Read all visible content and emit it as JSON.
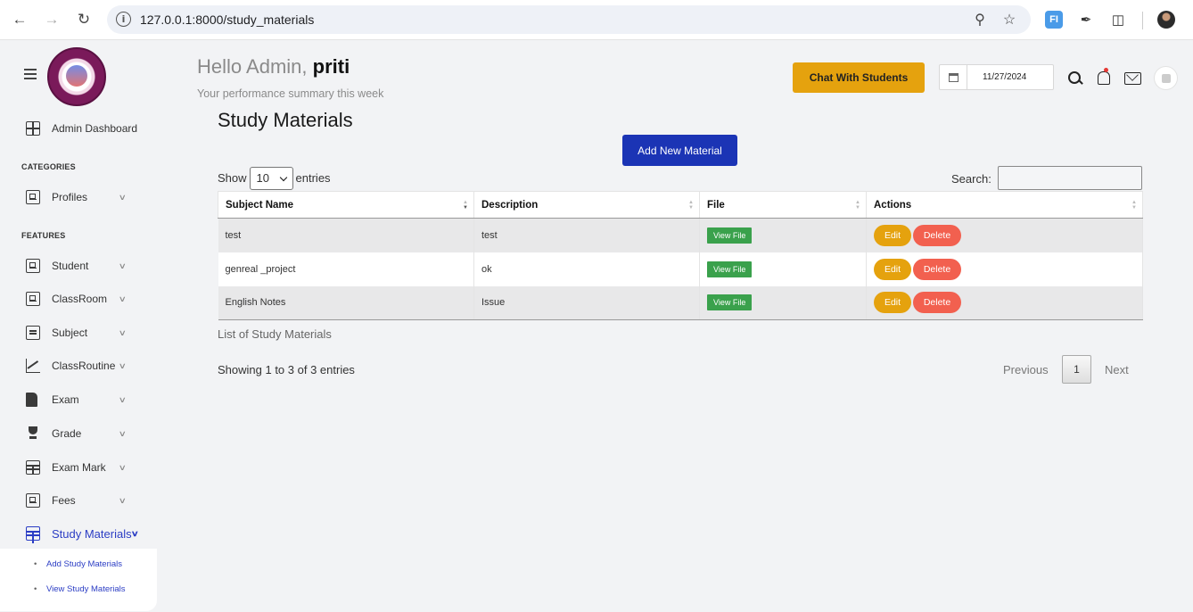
{
  "browser": {
    "url": "127.0.0.1:8000/study_materials",
    "extension_label": "FI"
  },
  "sidebar": {
    "dashboard_label": "Admin Dashboard",
    "categories_heading": "CATEGORIES",
    "features_heading": "FEATURES",
    "items": [
      {
        "label": "Profiles",
        "icon": "form-icon"
      },
      {
        "label": "Student",
        "icon": "form-icon"
      },
      {
        "label": "ClassRoom",
        "icon": "form-icon"
      },
      {
        "label": "Subject",
        "icon": "list-icon"
      },
      {
        "label": "ClassRoutine",
        "icon": "chart-icon"
      },
      {
        "label": "Exam",
        "icon": "document-icon"
      },
      {
        "label": "Grade",
        "icon": "trophy-icon"
      },
      {
        "label": "Exam Mark",
        "icon": "table-icon"
      },
      {
        "label": "Fees",
        "icon": "form-icon"
      },
      {
        "label": "Study Materials",
        "icon": "table-icon",
        "active": true
      }
    ],
    "subitems": [
      "Add Study Materials",
      "View Study Materials"
    ]
  },
  "header": {
    "greeting": "Hello Admin,",
    "username": "priti",
    "subtitle": "Your performance summary this week",
    "chat_button": "Chat With Students",
    "date_value": "11/27/2024"
  },
  "main": {
    "title": "Study Materials",
    "add_button": "Add New Material",
    "show_label": "Show",
    "entries_label": "entries",
    "page_length": "10",
    "search_label": "Search:",
    "search_value": "",
    "columns": [
      "Subject Name",
      "Description",
      "File",
      "Actions"
    ],
    "rows": [
      {
        "subject": "test",
        "description": "test",
        "file_label": "View File",
        "edit_label": "Edit",
        "delete_label": "Delete"
      },
      {
        "subject": "genreal _project",
        "description": "ok",
        "file_label": "View File",
        "edit_label": "Edit",
        "delete_label": "Delete"
      },
      {
        "subject": "English Notes",
        "description": "Issue",
        "file_label": "View File",
        "edit_label": "Edit",
        "delete_label": "Delete"
      }
    ],
    "caption": "List of Study Materials",
    "info": "Showing 1 to 3 of 3 entries",
    "pagination": {
      "previous": "Previous",
      "current": "1",
      "next": "Next"
    }
  },
  "colors": {
    "primary": "#1b34b5",
    "warning": "#e5a20e",
    "success": "#3aa14c",
    "danger": "#f2604f",
    "active_nav": "#2b3dc4"
  }
}
